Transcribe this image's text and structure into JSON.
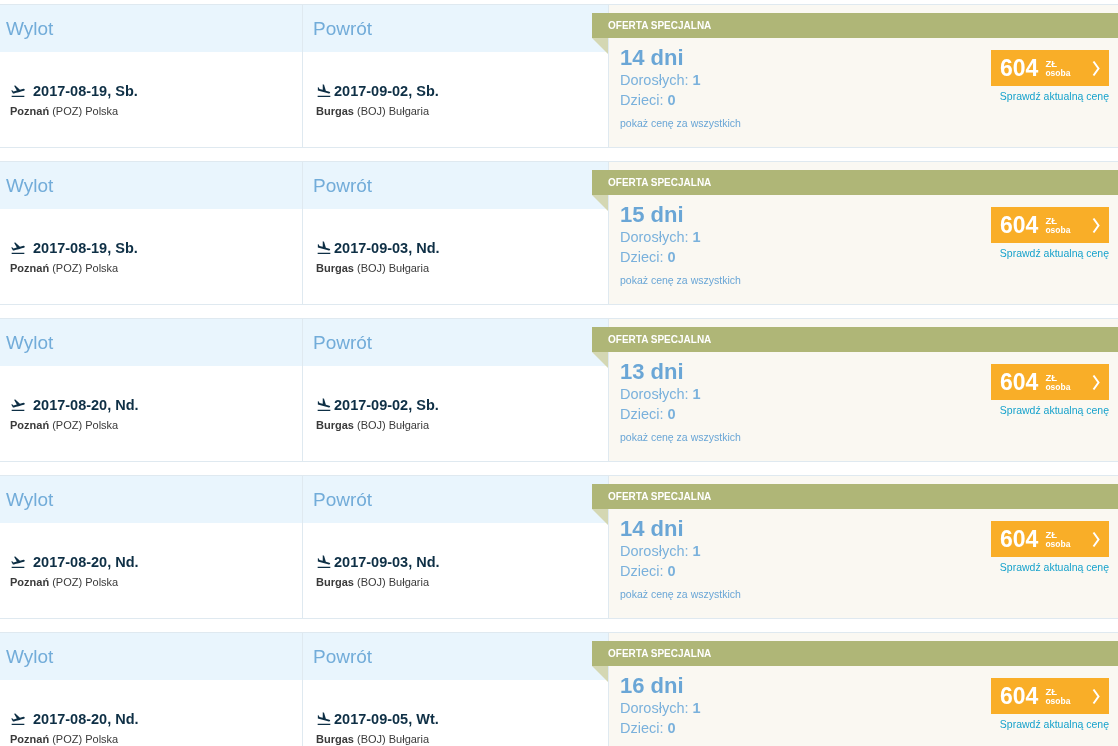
{
  "offers": [
    {
      "legs": [
        {
          "kind": "departure",
          "header": "Wylot",
          "date": "2017-08-19, Sb.",
          "place": "**Poznań** (POZ) Polska"
        },
        {
          "kind": "return",
          "header": "Powrót",
          "date": "2017-09-02, Sb.",
          "place": "**Burgas** (BOJ) Bułgaria"
        }
      ],
      "ribbon": "OFERTA SPECJALNA",
      "duration": "14 dni",
      "adults": "Dorosłych: **1**",
      "children": "Dzieci: **0**",
      "all_price_link": "pokaż cenę za wszystkich",
      "price": {
        "amount": "604",
        "currency": "ZŁ",
        "unit": "osoba"
      },
      "check_link": "Sprawdź aktualną cenę"
    },
    {
      "legs": [
        {
          "kind": "departure",
          "header": "Wylot",
          "date": "2017-08-19, Sb.",
          "place": "**Poznań** (POZ) Polska"
        },
        {
          "kind": "return",
          "header": "Powrót",
          "date": "2017-09-03, Nd.",
          "place": "**Burgas** (BOJ) Bułgaria"
        }
      ],
      "ribbon": "OFERTA SPECJALNA",
      "duration": "15 dni",
      "adults": "Dorosłych: **1**",
      "children": "Dzieci: **0**",
      "all_price_link": "pokaż cenę za wszystkich",
      "price": {
        "amount": "604",
        "currency": "ZŁ",
        "unit": "osoba"
      },
      "check_link": "Sprawdź aktualną cenę"
    },
    {
      "legs": [
        {
          "kind": "departure",
          "header": "Wylot",
          "date": "2017-08-20, Nd.",
          "place": "**Poznań** (POZ) Polska"
        },
        {
          "kind": "return",
          "header": "Powrót",
          "date": "2017-09-02, Sb.",
          "place": "**Burgas** (BOJ) Bułgaria"
        }
      ],
      "ribbon": "OFERTA SPECJALNA",
      "duration": "13 dni",
      "adults": "Dorosłych: **1**",
      "children": "Dzieci: **0**",
      "all_price_link": "pokaż cenę za wszystkich",
      "price": {
        "amount": "604",
        "currency": "ZŁ",
        "unit": "osoba"
      },
      "check_link": "Sprawdź aktualną cenę"
    },
    {
      "legs": [
        {
          "kind": "departure",
          "header": "Wylot",
          "date": "2017-08-20, Nd.",
          "place": "**Poznań** (POZ) Polska"
        },
        {
          "kind": "return",
          "header": "Powrót",
          "date": "2017-09-03, Nd.",
          "place": "**Burgas** (BOJ) Bułgaria"
        }
      ],
      "ribbon": "OFERTA SPECJALNA",
      "duration": "14 dni",
      "adults": "Dorosłych: **1**",
      "children": "Dzieci: **0**",
      "all_price_link": "pokaż cenę za wszystkich",
      "price": {
        "amount": "604",
        "currency": "ZŁ",
        "unit": "osoba"
      },
      "check_link": "Sprawdź aktualną cenę"
    },
    {
      "legs": [
        {
          "kind": "departure",
          "header": "Wylot",
          "date": "2017-08-20, Nd.",
          "place": "**Poznań** (POZ) Polska"
        },
        {
          "kind": "return",
          "header": "Powrót",
          "date": "2017-09-05, Wt.",
          "place": "**Burgas** (BOJ) Bułgaria"
        }
      ],
      "ribbon": "OFERTA SPECJALNA",
      "duration": "16 dni",
      "adults": "Dorosłych: **1**",
      "children": "Dzieci: **0**",
      "price": {
        "amount": "604",
        "currency": "ZŁ",
        "unit": "osoba"
      },
      "check_link": "Sprawdź aktualną cenę"
    }
  ]
}
